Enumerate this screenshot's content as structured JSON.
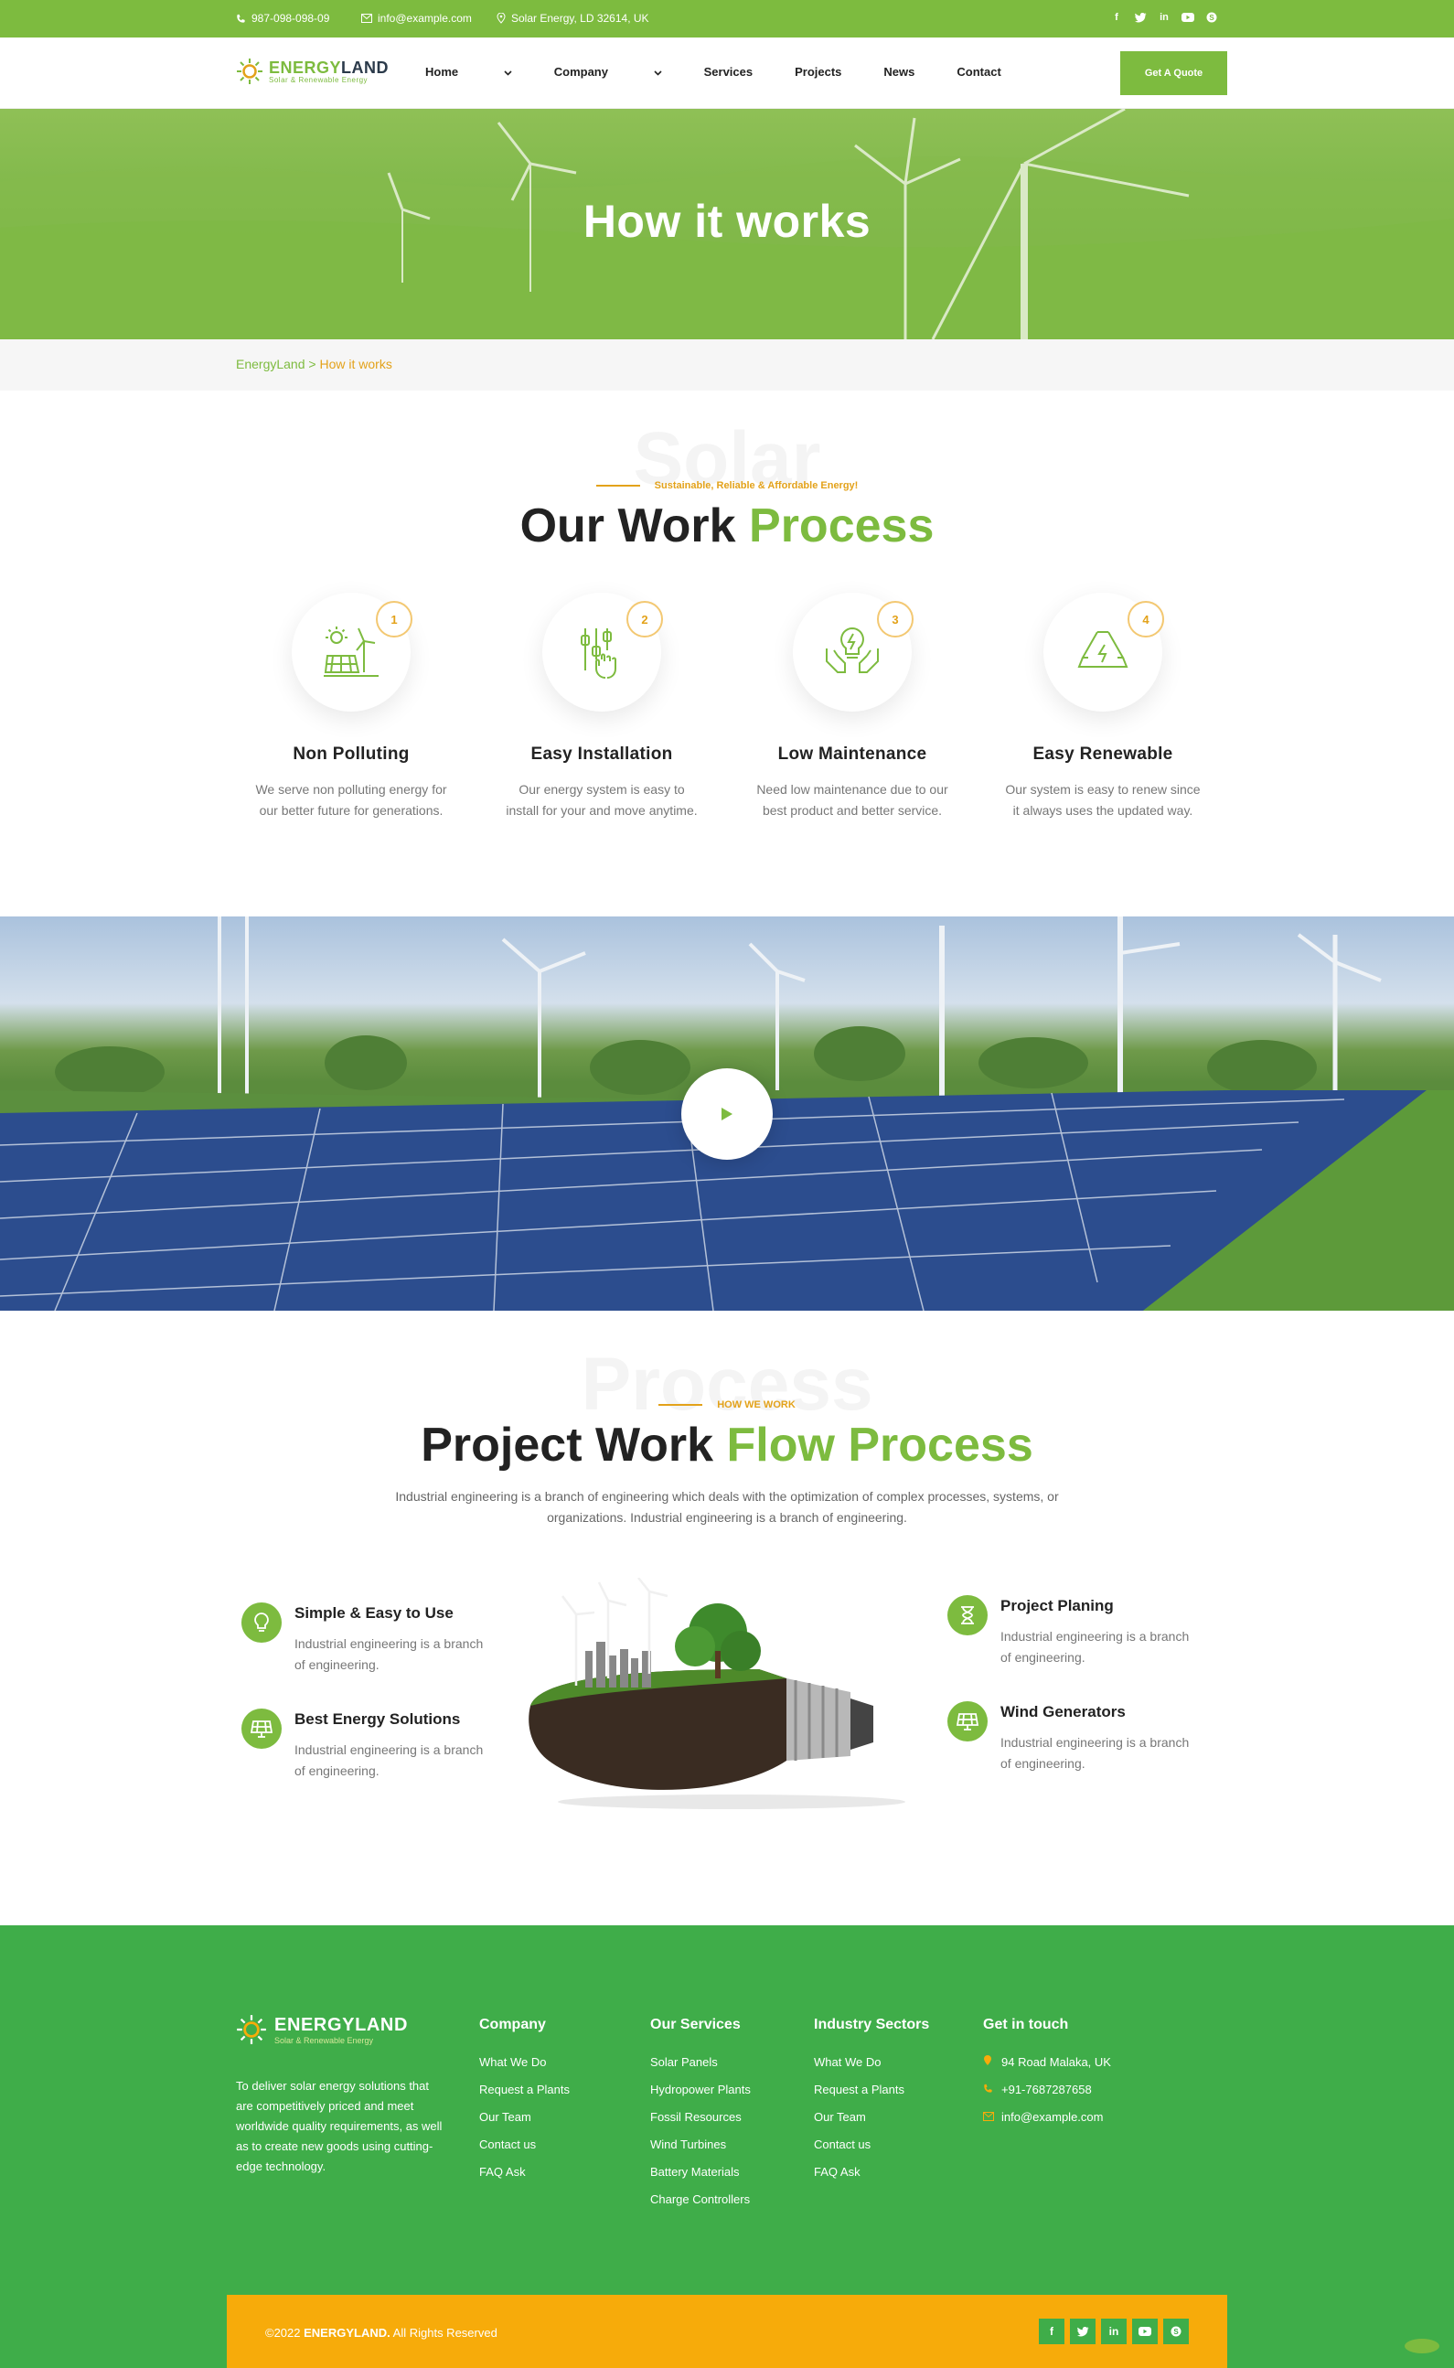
{
  "topbar": {
    "phone": "987-098-098-09",
    "email": "info@example.com",
    "address": "Solar Energy, LD 32614, UK",
    "socials": [
      "facebook-icon",
      "twitter-icon",
      "linkedin-icon",
      "youtube-icon",
      "skype-icon"
    ]
  },
  "brand": {
    "name_a": "ENERGY",
    "name_b": "LAND",
    "tagline": "Solar & Renewable Energy"
  },
  "nav": {
    "items": [
      "Home",
      "Company",
      "Services",
      "Projects",
      "News",
      "Contact"
    ],
    "cta": "Get A Quote"
  },
  "hero": {
    "title": "How it works"
  },
  "breadcrumb": {
    "home": "EnergyLand",
    "sep": ">",
    "current": "How it works"
  },
  "process": {
    "ghost": "Solar",
    "eyebrow": "Sustainable, Reliable & Affordable Energy!",
    "title_a": "Our Work",
    "title_b": "Process",
    "cards": [
      {
        "num": "1",
        "icon": "solar-windmill-icon",
        "title": "Non Polluting",
        "text_1": "We serve non polluting energy for",
        "text_2": "our better future for generations."
      },
      {
        "num": "2",
        "icon": "installation-hand-icon",
        "title": "Easy Installation",
        "text_1": "Our energy system is easy to",
        "text_2": "install for your and move anytime."
      },
      {
        "num": "3",
        "icon": "bulb-hands-icon",
        "title": "Low Maintenance",
        "text_1": "Need low maintenance due to our",
        "text_2": "best product and better service."
      },
      {
        "num": "4",
        "icon": "recycle-icon",
        "title": "Easy Renewable",
        "text_1": "Our system is easy to renew since",
        "text_2": "it always uses the updated way."
      }
    ]
  },
  "video": {
    "icon": "play-icon"
  },
  "flow": {
    "ghost": "Process",
    "eyebrow": "HOW WE WORK",
    "title_a": "Project Work",
    "title_b": "Flow Process",
    "intro_1": "Industrial engineering is a branch of engineering which deals with the optimization of complex processes, systems, or",
    "intro_2": "organizations. Industrial engineering is a branch of engineering.",
    "features": [
      {
        "icon": "bulb-icon",
        "title": "Simple & Easy to Use",
        "text_1": "Industrial engineering is a branch",
        "text_2": "of engineering."
      },
      {
        "icon": "solar-panel-icon",
        "title": "Best Energy Solutions",
        "text_1": "Industrial engineering is a branch",
        "text_2": "of engineering."
      },
      {
        "icon": "hourglass-icon",
        "title": "Project Planing",
        "text_1": "Industrial engineering is a branch",
        "text_2": "of engineering."
      },
      {
        "icon": "solar-panel-icon",
        "title": "Wind Generators",
        "text_1": "Industrial engineering is a branch",
        "text_2": "of engineering."
      }
    ]
  },
  "footer": {
    "brand": "ENERGYLAND",
    "tagline": "Solar & Renewable Energy",
    "about": "To deliver solar energy solutions that are competitively priced and meet worldwide quality requirements, as well as to create new goods using cutting-edge technology.",
    "company": {
      "title": "Company",
      "links": [
        "What We Do",
        "Request a Plants",
        "Our Team",
        "Contact us",
        "FAQ Ask"
      ]
    },
    "services": {
      "title": "Our Services",
      "links": [
        "Solar Panels",
        "Hydropower Plants",
        "Fossil Resources",
        "Wind Turbines",
        "Battery Materials",
        "Charge Controllers"
      ]
    },
    "sectors": {
      "title": "Industry Sectors",
      "links": [
        "What We Do",
        "Request a Plants",
        "Our Team",
        "Contact us",
        "FAQ Ask"
      ]
    },
    "contact": {
      "title": "Get in touch",
      "address": "94 Road Malaka, UK",
      "phone": "+91-7687287658",
      "email": "info@example.com"
    },
    "copyright_a": "©2022",
    "copyright_b": "ENERGYLAND.",
    "copyright_c": "All Rights Reserved"
  },
  "colors": {
    "green": "#7dbb3f",
    "footer_green": "#3fad49",
    "accent": "#e3a21a",
    "copy_bar": "#f7ab0a"
  }
}
